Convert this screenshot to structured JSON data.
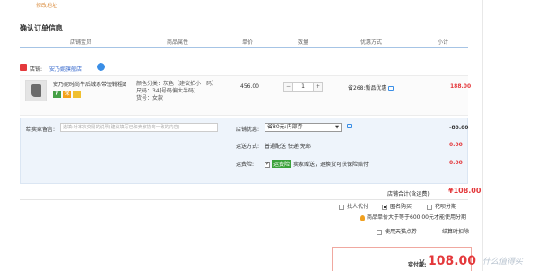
{
  "header": {
    "address_link": "修改地址",
    "page_title": "确认订单信息"
  },
  "columns": [
    "店铺宝贝",
    "商品属性",
    "单价",
    "数量",
    "优惠方式",
    "小计"
  ],
  "shop": {
    "label": "店铺:",
    "name": "安乃妮旗舰店"
  },
  "item": {
    "title": "安乃妮时尚牛后绒系带短靴粗跟...",
    "badge_7": "7",
    "attr_color": "颜色分类：灰色【建议拍小一码】",
    "attr_size": "尺码：34[号码偏大半码]",
    "attr_stock": "货号：女款",
    "unit_price": "456.00",
    "quantity": "1",
    "minus": "−",
    "plus": "+",
    "promo": "省268:新品优惠",
    "subtotal": "188.00"
  },
  "options": {
    "message_label": "给卖家留言:",
    "message_placeholder": "选填:对本次交易的说明(建议填写已和卖家协商一致的内容)",
    "store_promo_label": "店铺优惠:",
    "store_promo_select": "省80元:内部券",
    "store_promo_amount": "-80.00",
    "shipping_label": "运送方式:",
    "shipping_value": "普通配送 快递 免邮",
    "shipping_amount": "0.00",
    "insurance_label": "运费险:",
    "insurance_tag": "运费险",
    "insurance_text": "卖家赠送，退换货可获保险赔付",
    "insurance_amount": "0.00"
  },
  "store_total": {
    "label": "店铺合计(含运费)",
    "value": "¥108.00"
  },
  "pay_options": {
    "proxy_pay": "找人代付",
    "anonymous": "匿名购买",
    "pay_later": "花呗分期",
    "notice": "商品单价大于等于600.00元才能使用分期",
    "tianmao": "使用天猫点券",
    "settle": "结算时扣除"
  },
  "final": {
    "label": "实付款:",
    "currency": "¥",
    "value": "108.00"
  },
  "watermark": "什么值得买",
  "colors": {
    "accent_red": "#e4393c",
    "header_rule": "#a6c4e5",
    "option_bg": "#eef4fb",
    "link_blue": "#3366cc"
  }
}
